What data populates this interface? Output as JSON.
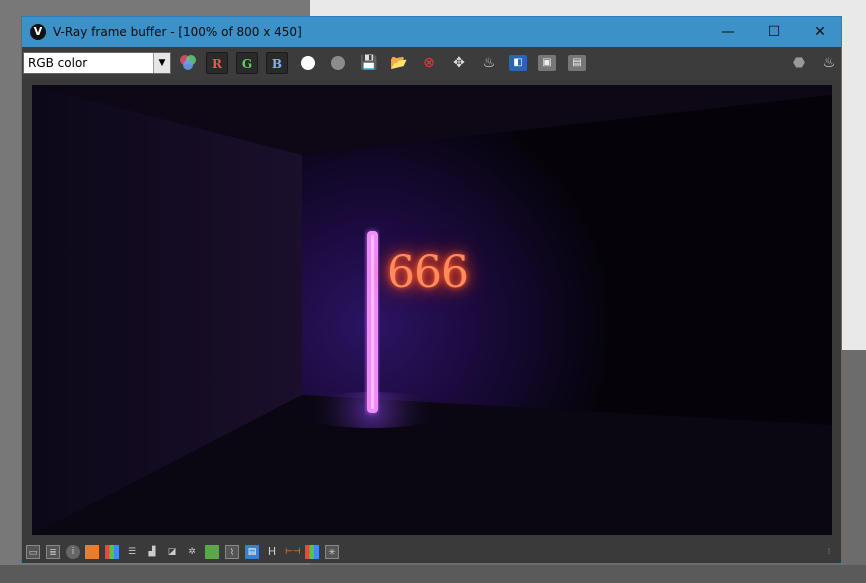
{
  "window": {
    "title": "V-Ray frame buffer - [100% of 800 x 450]",
    "logo_letter": "V",
    "controls": {
      "minimize": "—",
      "maximize": "☐",
      "close": "✕"
    }
  },
  "toolbar": {
    "channel_select": {
      "value": "RGB color"
    },
    "channels": {
      "r": "R",
      "g": "G",
      "b": "B"
    }
  },
  "render": {
    "text": "666",
    "colors": {
      "neon_tube": "#f08cff",
      "neon_text": "#ff8a5c",
      "room": "#0b0614"
    }
  },
  "statusbar": {
    "h_label": "H"
  }
}
